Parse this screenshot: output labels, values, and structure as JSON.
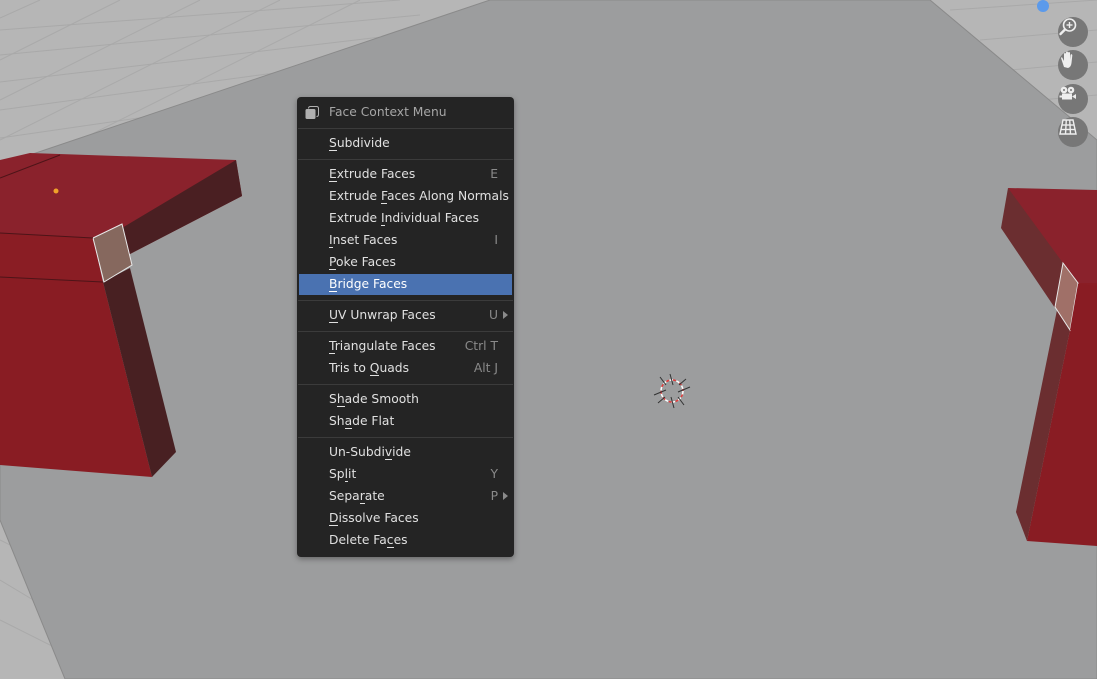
{
  "menu": {
    "title": "Face Context Menu",
    "title_icon": "face-mode-icon",
    "highlight_color": "#4a72b1",
    "items": [
      {
        "label": "Subdivide",
        "ul": "S",
        "pre": "",
        "post": "ubdivide",
        "shortcut": "",
        "submenu": false
      },
      {
        "label": "Extrude Faces",
        "pre": "",
        "ul": "E",
        "post": "xtrude Faces",
        "shortcut": "E",
        "submenu": false
      },
      {
        "label": "Extrude Faces Along Normals",
        "pre": "Extrude ",
        "ul": "F",
        "post": "aces Along Normals",
        "shortcut": "",
        "submenu": false
      },
      {
        "label": "Extrude Individual Faces",
        "pre": "Extrude ",
        "ul": "I",
        "post": "ndividual Faces",
        "shortcut": "",
        "submenu": false
      },
      {
        "label": "Inset Faces",
        "pre": "",
        "ul": "I",
        "post": "nset Faces",
        "shortcut": "I",
        "submenu": false
      },
      {
        "label": "Poke Faces",
        "pre": "",
        "ul": "P",
        "post": "oke Faces",
        "shortcut": "",
        "submenu": false
      },
      {
        "label": "Bridge Faces",
        "pre": "",
        "ul": "B",
        "post": "ridge Faces",
        "shortcut": "",
        "submenu": false,
        "active": true
      },
      {
        "label": "UV Unwrap Faces",
        "pre": "",
        "ul": "U",
        "post": "V Unwrap Faces",
        "shortcut": "U",
        "submenu": true
      },
      {
        "label": "Triangulate Faces",
        "pre": "",
        "ul": "T",
        "post": "riangulate Faces",
        "shortcut": "Ctrl T",
        "submenu": false
      },
      {
        "label": "Tris to Quads",
        "pre": "Tris to ",
        "ul": "Q",
        "post": "uads",
        "shortcut": "Alt J",
        "submenu": false
      },
      {
        "label": "Shade Smooth",
        "pre": "S",
        "ul": "h",
        "post": "ade Smooth",
        "shortcut": "",
        "submenu": false
      },
      {
        "label": "Shade Flat",
        "pre": "Sh",
        "ul": "a",
        "post": "de Flat",
        "shortcut": "",
        "submenu": false
      },
      {
        "label": "Un-Subdivide",
        "pre": "Un-Subdi",
        "ul": "v",
        "post": "ide",
        "shortcut": "",
        "submenu": false
      },
      {
        "label": "Split",
        "pre": "Sp",
        "ul": "l",
        "post": "it",
        "shortcut": "Y",
        "submenu": false
      },
      {
        "label": "Separate",
        "pre": "Sepa",
        "ul": "r",
        "post": "ate",
        "shortcut": "P",
        "submenu": true
      },
      {
        "label": "Dissolve Faces",
        "pre": "",
        "ul": "D",
        "post": "issolve Faces",
        "shortcut": "",
        "submenu": false
      },
      {
        "label": "Delete Faces",
        "pre": "Delete Fa",
        "ul": "c",
        "post": "es",
        "shortcut": "",
        "submenu": false
      }
    ]
  },
  "navigation": {
    "buttons": [
      {
        "name": "zoom-button",
        "icon": "magnifier-plus-icon"
      },
      {
        "name": "pan-button",
        "icon": "hand-icon"
      },
      {
        "name": "camera-view-button",
        "icon": "camera-icon"
      },
      {
        "name": "perspective-toggle-button",
        "icon": "grid-icon"
      }
    ]
  },
  "scene": {
    "object_color": "#8c1f26",
    "selected_face_color": "#8a6a62",
    "plane_color": "#9c9d9e",
    "grid_color": "#b8b8b8"
  }
}
